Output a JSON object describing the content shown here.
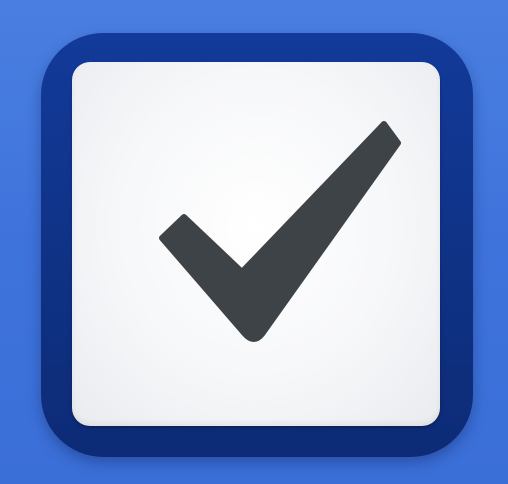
{
  "app_icon": {
    "icon": "checkmark-icon",
    "colors": {
      "background": "#4278de",
      "frame": "#113692",
      "tile": "#f5f6f8",
      "check": "#3e4348"
    }
  }
}
